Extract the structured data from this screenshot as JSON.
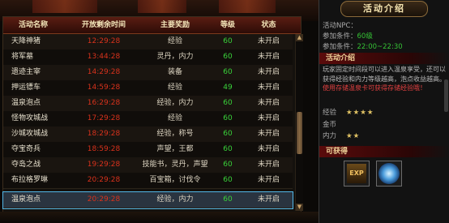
{
  "table": {
    "headers": [
      "活动名称",
      "开放剩余时间",
      "主要奖励",
      "等级",
      "状态"
    ],
    "rows": [
      {
        "name": "天降神猪",
        "time": "12:29:28",
        "reward": "经验",
        "level": "60",
        "status": "未开启"
      },
      {
        "name": "将军墓",
        "time": "13:44:28",
        "reward": "灵丹，内力",
        "level": "60",
        "status": "未开启"
      },
      {
        "name": "遗迹主宰",
        "time": "14:29:28",
        "reward": "装备",
        "level": "60",
        "status": "未开启"
      },
      {
        "name": "押运镖车",
        "time": "14:59:28",
        "reward": "经验",
        "level": "49",
        "status": "未开启"
      },
      {
        "name": "温泉泡点",
        "time": "16:29:28",
        "reward": "经验，内力",
        "level": "60",
        "status": "未开启"
      },
      {
        "name": "怪物攻城战",
        "time": "17:29:28",
        "reward": "经验",
        "level": "60",
        "status": "未开启"
      },
      {
        "name": "沙城攻城战",
        "time": "18:29:28",
        "reward": "经验，称号",
        "level": "60",
        "status": "未开启"
      },
      {
        "name": "夺宝奇兵",
        "time": "18:59:28",
        "reward": "声望，王都",
        "level": "60",
        "status": "未开启"
      },
      {
        "name": "夺岛之战",
        "time": "19:29:28",
        "reward": "技能书，灵丹，声望",
        "level": "60",
        "status": "未开启"
      },
      {
        "name": "布拉格罗琳",
        "time": "20:29:28",
        "reward": "百宝箱，讨伐令",
        "level": "60",
        "status": "未开启"
      },
      {
        "name": "温泉泡点",
        "time": "20:29:28",
        "reward": "经验，内力",
        "level": "60",
        "status": "未开启"
      }
    ],
    "selected_index": 10
  },
  "scroll": {
    "up_glyph": "▲",
    "down_glyph": "▼"
  },
  "info": {
    "title": "活动介绍",
    "npc_label": "活动NPC：",
    "cond1_label": "参加条件：",
    "cond1_value": "60级",
    "cond2_label": "参加条件：",
    "cond2_value": "22:00~22:30",
    "intro_heading": "活动介绍",
    "desc_text": "玩家固定时间段可以进入温泉享受，还可以获得经验和内力等级越高，泡点收益越高。",
    "desc_highlight": "使用存储温泉卡可获得存储经验哦！",
    "exp_label": "经验",
    "exp_stars": "★★★★",
    "gold_label": "金币",
    "gold_stars": "",
    "inner_label": "内力",
    "inner_stars": "★★",
    "rewards_heading": "可获得",
    "item1_text": "EXP"
  },
  "colors": {
    "time_red": "#d8321c",
    "level_green": "#39d33a",
    "selected_outline": "#52b7e8"
  }
}
